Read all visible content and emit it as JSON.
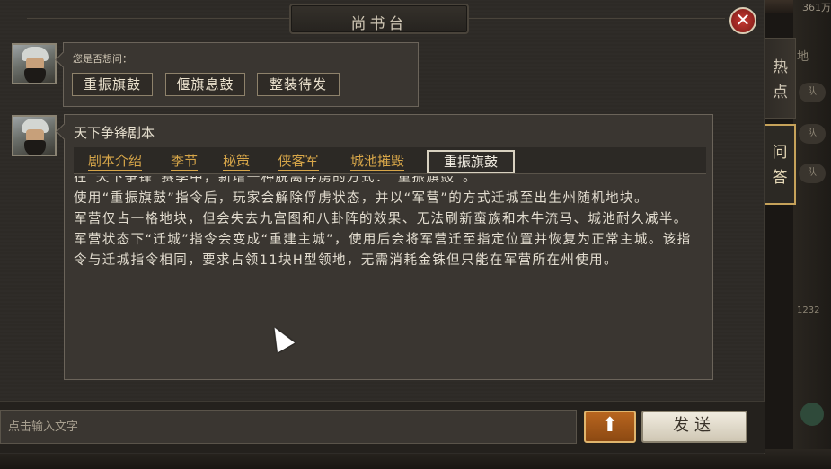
{
  "window": {
    "title": "尚书台",
    "close_label": "✕"
  },
  "background": {
    "money_text": "361万",
    "side_label": "地",
    "row_label": "队",
    "map_counter": "1232"
  },
  "side_tabs": [
    {
      "label": "热点",
      "active": false
    },
    {
      "label": "问答",
      "active": true
    }
  ],
  "first_message": {
    "prompt": "您是否想问：",
    "suggestions": [
      "重振旗鼓",
      "偃旗息鼓",
      "整装待发"
    ]
  },
  "second_message": {
    "title": "天下争锋剧本",
    "tabs": [
      "剧本介绍",
      "季节",
      "秘策",
      "侠客军",
      "城池摧毁",
      "重振旗鼓"
    ],
    "active_tab": "重振旗鼓",
    "paragraphs": [
      "在“天下争锋”赛季中，新增一种脱离俘虏的方式：“重振旗鼓”。",
      "使用“重振旗鼓”指令后，玩家会解除俘虏状态，并以“军营”的方式迁城至出生州随机地块。",
      "军营仅占一格地块，但会失去九宫图和八卦阵的效果、无法刷新蛮族和木牛流马、城池耐久减半。",
      "军营状态下“迁城”指令会变成“重建主城”，使用后会将军营迁至指定位置并恢复为正常主城。该指令与迁城指令相同，要求占领11块H型领地，无需消耗金铢但只能在军营所在州使用。"
    ]
  },
  "input_bar": {
    "placeholder": "点击输入文字",
    "up_icon": "arrow-up-icon",
    "up_symbol": "⬆",
    "send_label": "发送"
  },
  "colors": {
    "accent": "#d7a649",
    "close": "#c83a33",
    "up_button": "#b8651f"
  }
}
